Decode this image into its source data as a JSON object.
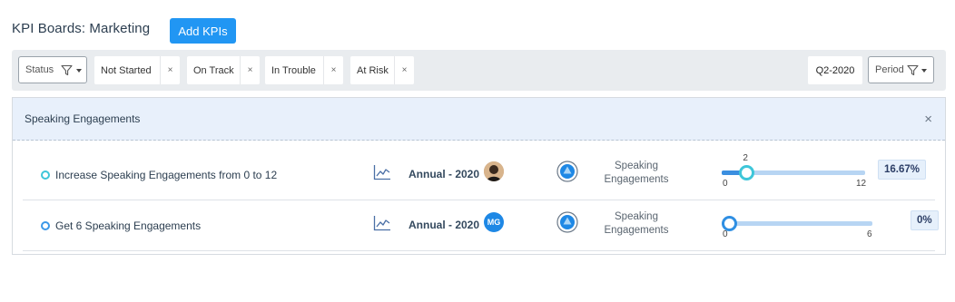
{
  "header": {
    "title": "KPI Boards: Marketing",
    "add_button": "Add KPIs"
  },
  "filters": {
    "status_label": "Status",
    "chips": [
      {
        "label": "Not Started"
      },
      {
        "label": "On Track"
      },
      {
        "label": "In Trouble"
      },
      {
        "label": "At Risk"
      }
    ],
    "chip_remove": "×",
    "quarter": "Q2-2020",
    "period_label": "Period"
  },
  "board": {
    "title": "Speaking Engagements",
    "close": "×",
    "rows": [
      {
        "name": "Increase Speaking Engagements from 0 to 12",
        "period": "Annual - 2020",
        "owner": "photo",
        "metric": "Speaking Engagements",
        "current": "2",
        "min": "0",
        "max": "12",
        "progress": 0.1667,
        "percent": "16.67%"
      },
      {
        "name": "Get 6 Speaking Engagements",
        "period": "Annual - 2020",
        "owner": "MG",
        "metric": "Speaking Engagements",
        "current": "",
        "min": "0",
        "max": "6",
        "progress": 0,
        "percent": "0%"
      }
    ]
  },
  "colors": {
    "primary": "#2196f3",
    "on_track": "#3ec6d9",
    "not_started": "#3b98e8",
    "header_bg": "#e8f0fb"
  },
  "icons": [
    "funnel-icon",
    "chevron-down-icon",
    "close-icon",
    "trend-chart-icon",
    "direction-up-icon"
  ]
}
